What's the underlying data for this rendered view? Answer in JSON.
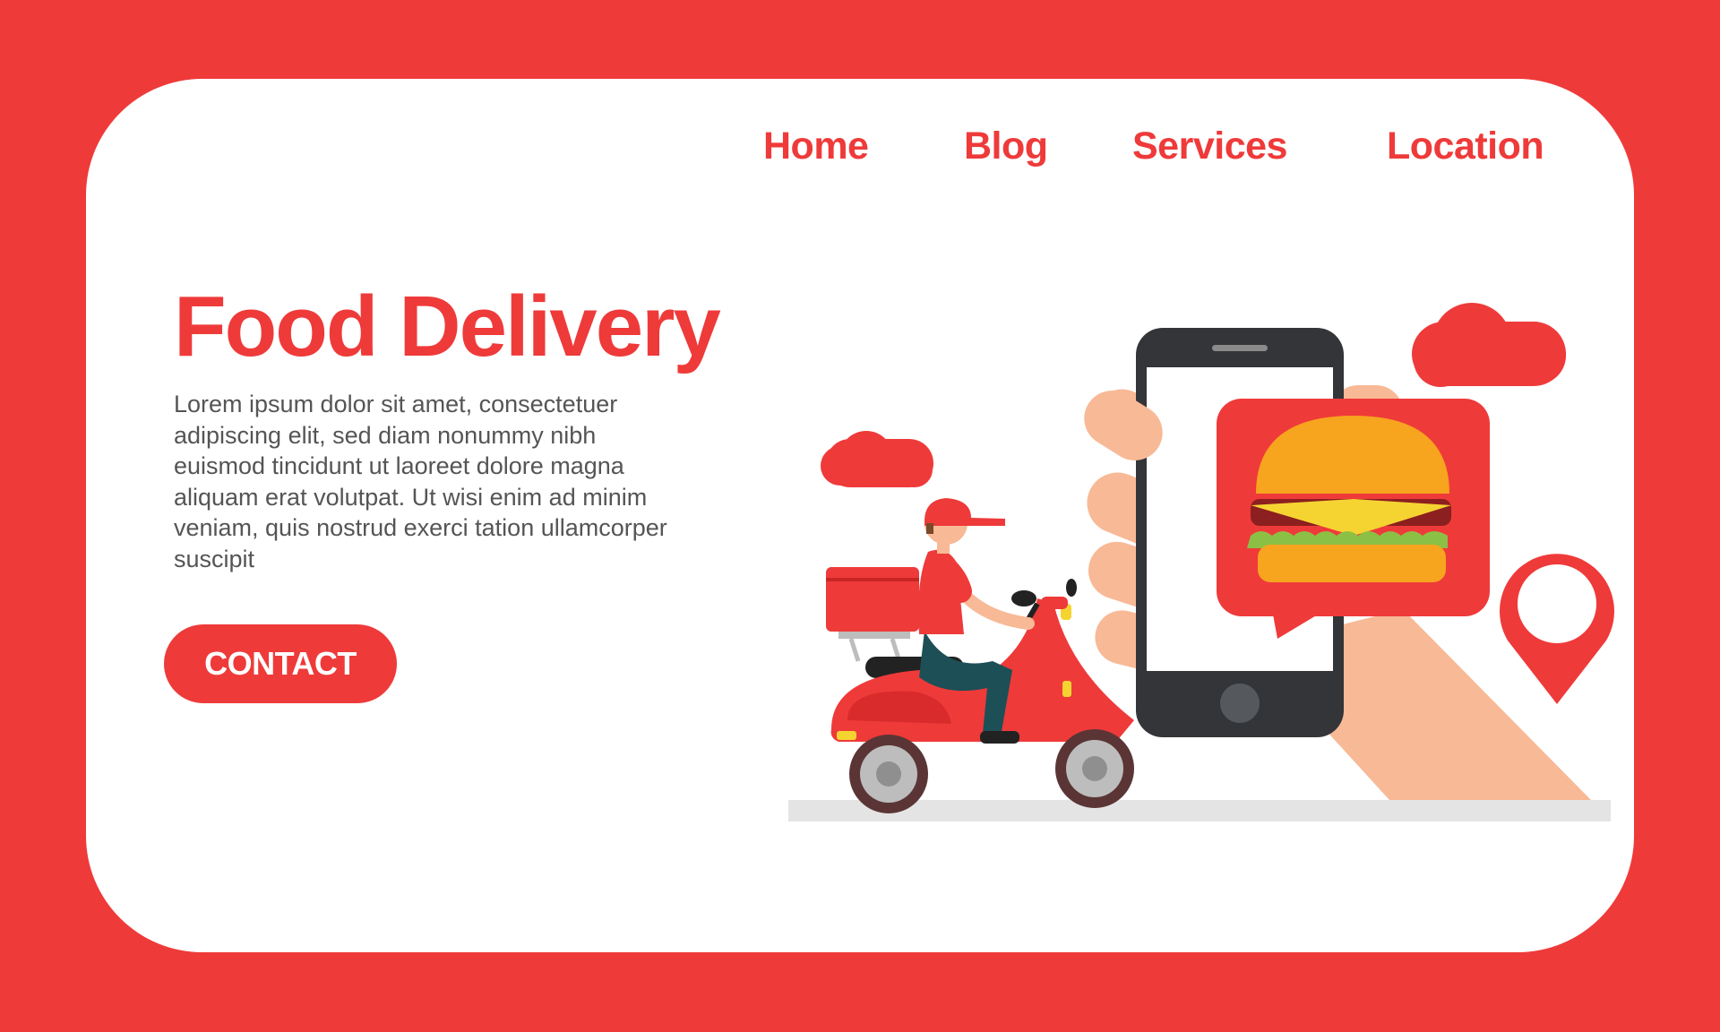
{
  "nav": {
    "items": [
      {
        "label": "Home"
      },
      {
        "label": "Blog"
      },
      {
        "label": "Services"
      },
      {
        "label": "Location"
      }
    ]
  },
  "hero": {
    "title": "Food Delivery",
    "body": "Lorem ipsum dolor sit amet, consectetuer adipiscing elit, sed diam nonummy nibh euismod tincidunt ut laoreet dolore magna aliquam erat volutpat. Ut wisi enim ad minim veniam, quis nostrud exerci tation ullamcorper suscipit",
    "cta_label": "CONTACT"
  },
  "colors": {
    "brand_red": "#ef3a3a",
    "phone_dark": "#333538",
    "skin": "#f8b996",
    "bun": "#f7a41e"
  },
  "icons": [
    "cloud-icon",
    "smartphone-icon",
    "burger-icon",
    "location-pin-icon",
    "scooter-icon",
    "delivery-rider-icon",
    "hand-icon"
  ]
}
